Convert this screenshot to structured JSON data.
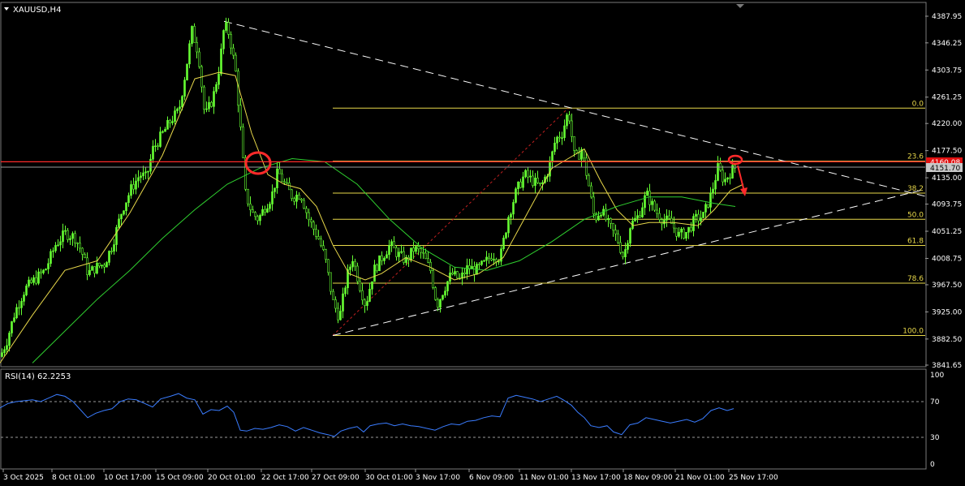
{
  "symbol": "XAUUSD,H4",
  "rsi_label": "RSI(14) 62.2253",
  "price_tag_red": "4160.08",
  "price_tag_gray": "4151.70",
  "colors": {
    "background": "#000000",
    "candle": "#66ff33",
    "ma_fast": "#e8d84a",
    "ma_slow": "#2fcf2f",
    "fib": "#e8d84a",
    "resistance": "#ff2a2a",
    "rsi": "#3a7cff",
    "trendline": "#ffffff",
    "marker": "#ff2a2a"
  },
  "chart_data": [
    {
      "type": "candlestick",
      "title": "XAUUSD,H4",
      "ylim": [
        3841.65,
        4387.95
      ],
      "y_ticks": [
        3841.65,
        3882.5,
        3925.0,
        3967.5,
        4008.75,
        4051.25,
        4093.75,
        4135.0,
        4177.5,
        4220.0,
        4261.25,
        4303.75,
        4346.25,
        4387.95
      ],
      "y_tick_labels": [
        "3841.65",
        "3882.50",
        "3925.00",
        "3967.50",
        "4008.75",
        "4051.25",
        "4093.75",
        "4135.00",
        "4177.50",
        "4220.00",
        "4261.25",
        "4303.75",
        "4346.25",
        "4387.95"
      ],
      "x_tick_labels": [
        "3 Oct 2025",
        "8 Oct 01:00",
        "10 Oct 17:00",
        "15 Oct 09:00",
        "20 Oct 01:00",
        "22 Oct 17:00",
        "27 Oct 09:00",
        "30 Oct 01:00",
        "3 Nov 17:00",
        "6 Nov 09:00",
        "11 Nov 01:00",
        "13 Nov 17:00",
        "18 Nov 09:00",
        "21 Nov 01:00",
        "25 Nov 17:00"
      ],
      "close_path": [
        [
          0,
          3855
        ],
        [
          8,
          3880
        ],
        [
          18,
          3925
        ],
        [
          30,
          3960
        ],
        [
          42,
          3975
        ],
        [
          55,
          3990
        ],
        [
          68,
          4030
        ],
        [
          80,
          4048
        ],
        [
          92,
          4042
        ],
        [
          100,
          4020
        ],
        [
          108,
          3985
        ],
        [
          118,
          3995
        ],
        [
          128,
          4000
        ],
        [
          138,
          4030
        ],
        [
          150,
          4085
        ],
        [
          162,
          4120
        ],
        [
          172,
          4140
        ],
        [
          180,
          4135
        ],
        [
          188,
          4180
        ],
        [
          198,
          4200
        ],
        [
          210,
          4225
        ],
        [
          220,
          4240
        ],
        [
          228,
          4300
        ],
        [
          236,
          4365
        ],
        [
          244,
          4330
        ],
        [
          252,
          4230
        ],
        [
          262,
          4260
        ],
        [
          270,
          4310
        ],
        [
          276,
          4375
        ],
        [
          282,
          4360
        ],
        [
          290,
          4300
        ],
        [
          296,
          4210
        ],
        [
          302,
          4110
        ],
        [
          310,
          4080
        ],
        [
          318,
          4070
        ],
        [
          326,
          4090
        ],
        [
          334,
          4105
        ],
        [
          342,
          4145
        ],
        [
          350,
          4125
        ],
        [
          360,
          4105
        ],
        [
          370,
          4110
        ],
        [
          380,
          4070
        ],
        [
          392,
          4040
        ],
        [
          400,
          4010
        ],
        [
          410,
          3940
        ],
        [
          418,
          3915
        ],
        [
          426,
          3975
        ],
        [
          434,
          4010
        ],
        [
          442,
          3970
        ],
        [
          450,
          3935
        ],
        [
          460,
          3990
        ],
        [
          470,
          4010
        ],
        [
          480,
          4030
        ],
        [
          490,
          4015
        ],
        [
          500,
          4005
        ],
        [
          510,
          4025
        ],
        [
          520,
          4015
        ],
        [
          530,
          3990
        ],
        [
          538,
          3935
        ],
        [
          546,
          3960
        ],
        [
          556,
          3985
        ],
        [
          566,
          3975
        ],
        [
          576,
          3995
        ],
        [
          586,
          3990
        ],
        [
          596,
          4000
        ],
        [
          606,
          4015
        ],
        [
          616,
          4010
        ],
        [
          626,
          4075
        ],
        [
          636,
          4115
        ],
        [
          646,
          4140
        ],
        [
          656,
          4130
        ],
        [
          666,
          4120
        ],
        [
          676,
          4150
        ],
        [
          684,
          4195
        ],
        [
          692,
          4205
        ],
        [
          700,
          4240
        ],
        [
          708,
          4160
        ],
        [
          716,
          4180
        ],
        [
          724,
          4130
        ],
        [
          732,
          4070
        ],
        [
          740,
          4085
        ],
        [
          750,
          4060
        ],
        [
          760,
          4040
        ],
        [
          768,
          4010
        ],
        [
          776,
          4060
        ],
        [
          786,
          4075
        ],
        [
          796,
          4110
        ],
        [
          806,
          4085
        ],
        [
          816,
          4070
        ],
        [
          826,
          4065
        ],
        [
          836,
          4045
        ],
        [
          846,
          4050
        ],
        [
          856,
          4070
        ],
        [
          866,
          4075
        ],
        [
          876,
          4110
        ],
        [
          884,
          4150
        ],
        [
          892,
          4130
        ],
        [
          900,
          4145
        ],
        [
          906,
          4151.7
        ]
      ],
      "series": [
        {
          "values_note": "",
          "name": "",
          "kind": "ma_fast",
          "points": [
            [
              0,
              3845
            ],
            [
              40,
              3920
            ],
            [
              80,
              3990
            ],
            [
              120,
              4005
            ],
            [
              160,
              4080
            ],
            [
              200,
              4170
            ],
            [
              240,
              4290
            ],
            [
              270,
              4300
            ],
            [
              290,
              4295
            ],
            [
              310,
              4205
            ],
            [
              330,
              4140
            ],
            [
              350,
              4125
            ],
            [
              370,
              4118
            ],
            [
              390,
              4090
            ],
            [
              410,
              4030
            ],
            [
              430,
              3985
            ],
            [
              450,
              3975
            ],
            [
              470,
              3985
            ],
            [
              500,
              4010
            ],
            [
              530,
              3995
            ],
            [
              560,
              3975
            ],
            [
              590,
              3985
            ],
            [
              620,
              4010
            ],
            [
              650,
              4080
            ],
            [
              680,
              4150
            ],
            [
              700,
              4165
            ],
            [
              720,
              4180
            ],
            [
              740,
              4130
            ],
            [
              760,
              4085
            ],
            [
              780,
              4060
            ],
            [
              800,
              4065
            ],
            [
              830,
              4065
            ],
            [
              860,
              4060
            ],
            [
              880,
              4085
            ],
            [
              900,
              4115
            ],
            [
              916,
              4125
            ]
          ]
        },
        {
          "values_note": "",
          "name": "",
          "kind": "ma_slow",
          "points": [
            [
              40,
              3845
            ],
            [
              80,
              3895
            ],
            [
              120,
              3945
            ],
            [
              160,
              3990
            ],
            [
              200,
              4040
            ],
            [
              240,
              4085
            ],
            [
              280,
              4125
            ],
            [
              320,
              4150
            ],
            [
              360,
              4165
            ],
            [
              400,
              4160
            ],
            [
              440,
              4125
            ],
            [
              480,
              4070
            ],
            [
              520,
              4025
            ],
            [
              560,
              3995
            ],
            [
              600,
              3990
            ],
            [
              640,
              4005
            ],
            [
              680,
              4035
            ],
            [
              720,
              4070
            ],
            [
              760,
              4090
            ],
            [
              800,
              4105
            ],
            [
              840,
              4105
            ],
            [
              880,
              4095
            ],
            [
              906,
              4090
            ]
          ]
        }
      ],
      "fibonacci": [
        {
          "level": "0.0",
          "price": 4244
        },
        {
          "level": "23.6",
          "price": 4161
        },
        {
          "level": "38.2",
          "price": 4111
        },
        {
          "level": "50.0",
          "price": 4070
        },
        {
          "level": "61.8",
          "price": 4029
        },
        {
          "level": "78.6",
          "price": 3970
        },
        {
          "level": "100.0",
          "price": 3888
        }
      ],
      "resistance_price": 4160.08,
      "current_price": 4151.7
    },
    {
      "type": "line",
      "title": "RSI(14) 62.2253",
      "ylim": [
        0,
        100
      ],
      "y_ticks": [
        0,
        30,
        70,
        100
      ],
      "levels": [
        30,
        70
      ],
      "points": [
        [
          0,
          63
        ],
        [
          10,
          68
        ],
        [
          20,
          70
        ],
        [
          30,
          71
        ],
        [
          40,
          72
        ],
        [
          50,
          70
        ],
        [
          60,
          74
        ],
        [
          70,
          78
        ],
        [
          80,
          76
        ],
        [
          90,
          70
        ],
        [
          100,
          60
        ],
        [
          108,
          52
        ],
        [
          118,
          57
        ],
        [
          128,
          60
        ],
        [
          138,
          62
        ],
        [
          148,
          70
        ],
        [
          158,
          73
        ],
        [
          168,
          72
        ],
        [
          178,
          68
        ],
        [
          188,
          64
        ],
        [
          198,
          73
        ],
        [
          210,
          76
        ],
        [
          220,
          79
        ],
        [
          230,
          74
        ],
        [
          240,
          72
        ],
        [
          250,
          56
        ],
        [
          260,
          61
        ],
        [
          270,
          60
        ],
        [
          280,
          65
        ],
        [
          288,
          58
        ],
        [
          296,
          38
        ],
        [
          304,
          37
        ],
        [
          314,
          40
        ],
        [
          324,
          39
        ],
        [
          334,
          41
        ],
        [
          344,
          44
        ],
        [
          354,
          42
        ],
        [
          364,
          37
        ],
        [
          374,
          41
        ],
        [
          384,
          38
        ],
        [
          394,
          35
        ],
        [
          404,
          33
        ],
        [
          412,
          31
        ],
        [
          420,
          37
        ],
        [
          430,
          40
        ],
        [
          440,
          42
        ],
        [
          448,
          36
        ],
        [
          456,
          43
        ],
        [
          466,
          45
        ],
        [
          476,
          46
        ],
        [
          486,
          43
        ],
        [
          496,
          45
        ],
        [
          506,
          43
        ],
        [
          516,
          42
        ],
        [
          526,
          40
        ],
        [
          536,
          38
        ],
        [
          546,
          42
        ],
        [
          556,
          45
        ],
        [
          566,
          44
        ],
        [
          576,
          48
        ],
        [
          586,
          49
        ],
        [
          596,
          52
        ],
        [
          606,
          54
        ],
        [
          616,
          53
        ],
        [
          626,
          74
        ],
        [
          636,
          77
        ],
        [
          646,
          75
        ],
        [
          656,
          73
        ],
        [
          666,
          70
        ],
        [
          676,
          73
        ],
        [
          686,
          76
        ],
        [
          694,
          72
        ],
        [
          704,
          66
        ],
        [
          712,
          58
        ],
        [
          720,
          52
        ],
        [
          728,
          43
        ],
        [
          738,
          41
        ],
        [
          748,
          43
        ],
        [
          756,
          36
        ],
        [
          766,
          33
        ],
        [
          776,
          44
        ],
        [
          786,
          46
        ],
        [
          796,
          52
        ],
        [
          806,
          50
        ],
        [
          816,
          48
        ],
        [
          826,
          46
        ],
        [
          836,
          48
        ],
        [
          846,
          50
        ],
        [
          856,
          47
        ],
        [
          866,
          51
        ],
        [
          876,
          60
        ],
        [
          886,
          63
        ],
        [
          896,
          60
        ],
        [
          904,
          62.2
        ]
      ]
    }
  ]
}
